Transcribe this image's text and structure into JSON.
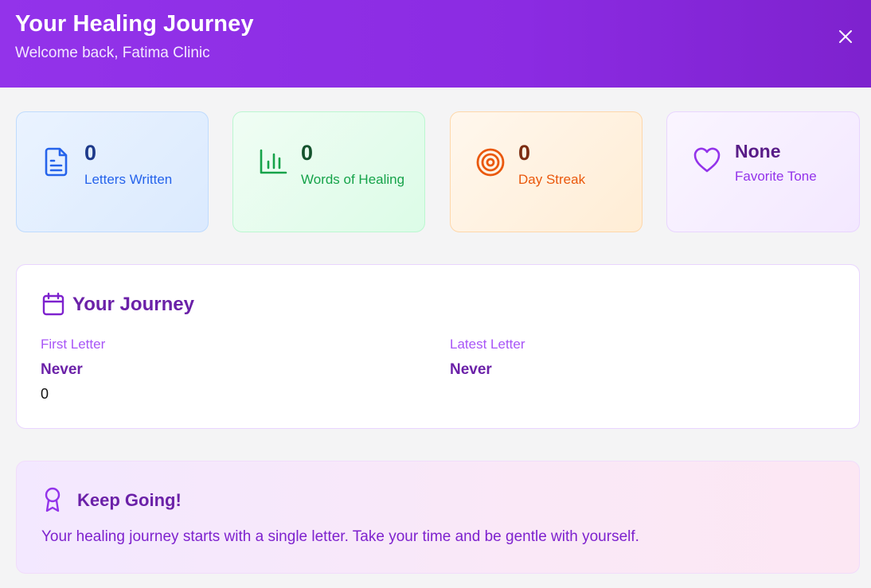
{
  "header": {
    "title": "Your Healing Journey",
    "subtitle": "Welcome back, Fatima Clinic",
    "close_icon": "close-icon"
  },
  "stats": [
    {
      "value": "0",
      "label": "Letters Written",
      "icon": "document-icon",
      "accent": "#2563eb"
    },
    {
      "value": "0",
      "label": "Words of Healing",
      "icon": "bar-chart-icon",
      "accent": "#16a34a"
    },
    {
      "value": "0",
      "label": "Day Streak",
      "icon": "target-icon",
      "accent": "#ea580c"
    },
    {
      "value": "None",
      "label": "Favorite Tone",
      "icon": "heart-icon",
      "accent": "#9333ea"
    }
  ],
  "journey": {
    "title": "Your Journey",
    "icon": "calendar-icon",
    "first_letter_label": "First Letter",
    "first_letter_value": "Never",
    "first_letter_extra": "0",
    "latest_letter_label": "Latest Letter",
    "latest_letter_value": "Never"
  },
  "encouragement": {
    "title": "Keep Going!",
    "icon": "award-icon",
    "text": "Your healing journey starts with a single letter. Take your time and be gentle with yourself."
  },
  "colors": {
    "header_gradient_start": "#9333ea",
    "header_gradient_end": "#7e22ce",
    "primary_text": "#6b21a8"
  }
}
